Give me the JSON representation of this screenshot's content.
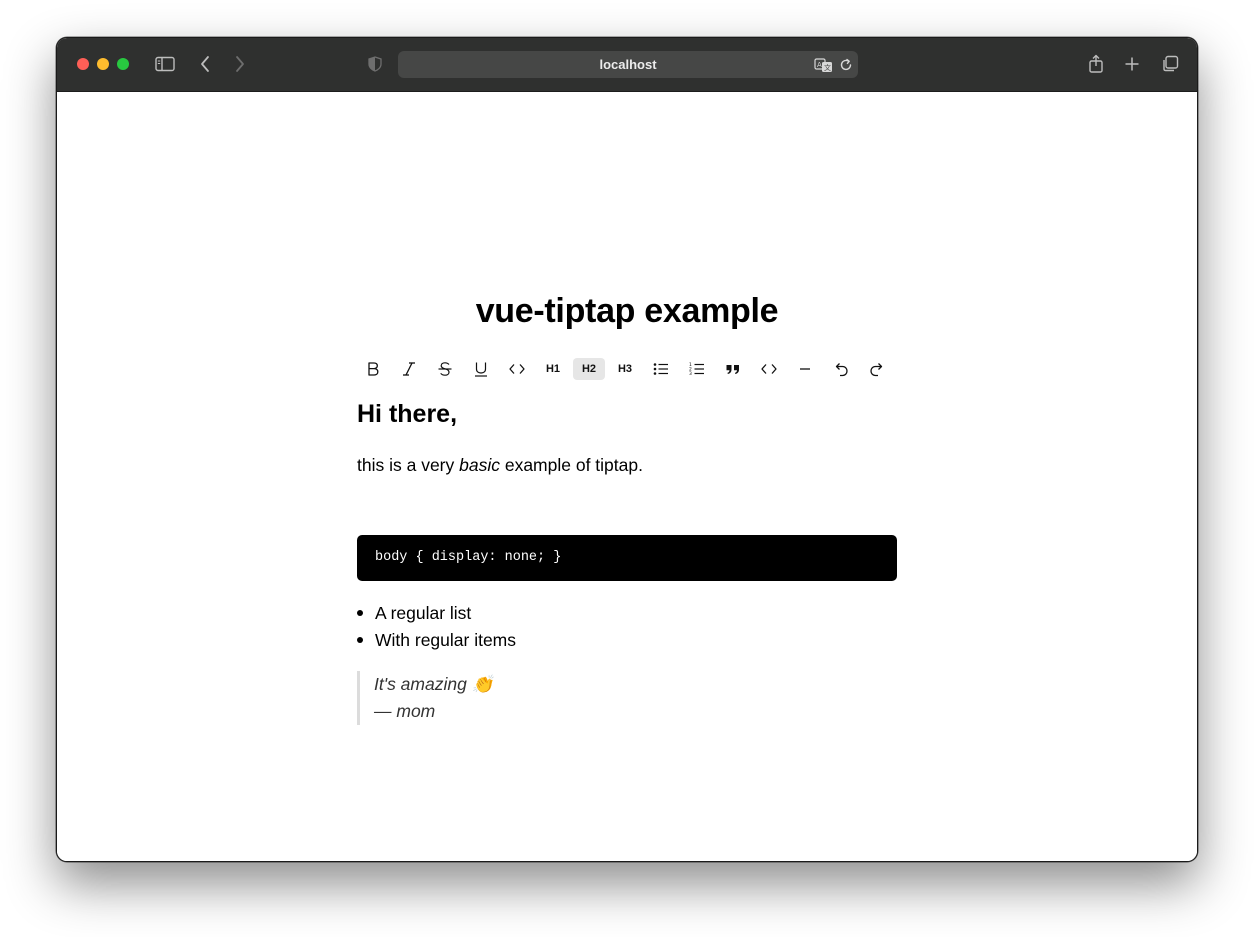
{
  "browser": {
    "url": "localhost",
    "icons": [
      "sidebar-icon",
      "back-icon",
      "forward-icon",
      "shield-icon",
      "translate-icon",
      "reload-icon",
      "share-icon",
      "new-tab-icon",
      "tabs-overview-icon"
    ]
  },
  "page": {
    "title": "vue-tiptap example"
  },
  "toolbar": {
    "buttons": [
      {
        "name": "bold",
        "icon": "bold-icon"
      },
      {
        "name": "italic",
        "icon": "italic-icon"
      },
      {
        "name": "strike",
        "icon": "strikethrough-icon"
      },
      {
        "name": "underline",
        "icon": "underline-icon"
      },
      {
        "name": "code",
        "icon": "code-icon"
      },
      {
        "name": "h1",
        "label": "H1"
      },
      {
        "name": "h2",
        "label": "H2",
        "active": true
      },
      {
        "name": "h3",
        "label": "H3"
      },
      {
        "name": "bullet-list",
        "icon": "bullet-list-icon"
      },
      {
        "name": "ordered-list",
        "icon": "ordered-list-icon"
      },
      {
        "name": "blockquote",
        "icon": "quote-icon"
      },
      {
        "name": "code-block",
        "icon": "code-block-icon"
      },
      {
        "name": "horizontal-rule",
        "icon": "horizontal-rule-icon"
      },
      {
        "name": "undo",
        "icon": "undo-icon"
      },
      {
        "name": "redo",
        "icon": "redo-icon"
      }
    ]
  },
  "editor": {
    "heading": "Hi there,",
    "paragraph": {
      "before": "this is a very ",
      "emphasis": "basic",
      "after": " example of tiptap."
    },
    "code": "body { display: none; }",
    "list": [
      "A regular list",
      "With regular items"
    ],
    "quote": {
      "text": "It's amazing 👏",
      "author": "— mom"
    }
  },
  "colors": {
    "titlebar": "#2f302f",
    "code_background": "#000000",
    "active_button": "#e6e6e6"
  }
}
